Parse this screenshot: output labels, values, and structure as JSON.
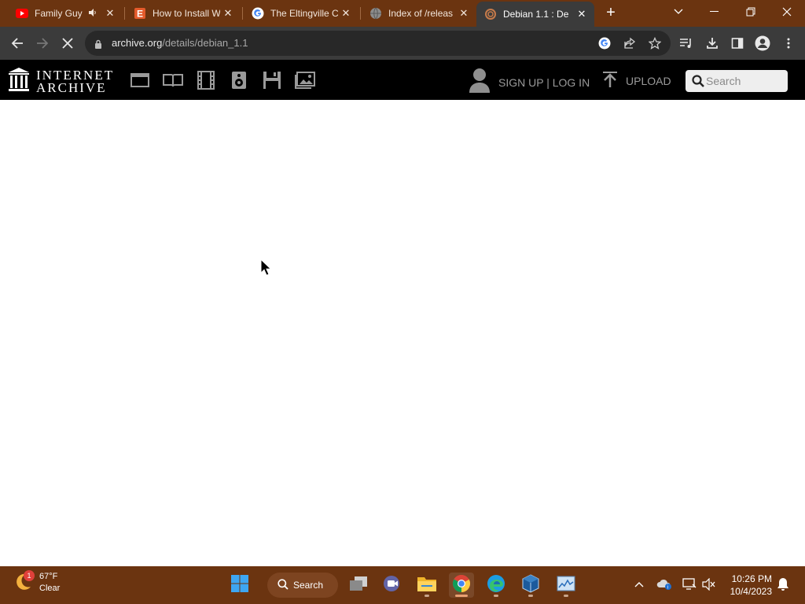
{
  "browser": {
    "tabs": [
      {
        "title": "Family Guy",
        "favicon": "youtube-icon",
        "audio": true,
        "active": false
      },
      {
        "title": "How to Install W",
        "favicon": "elementor-e-icon",
        "audio": false,
        "active": false
      },
      {
        "title": "The Eltingville C",
        "favicon": "google-g-icon",
        "audio": false,
        "active": false
      },
      {
        "title": "Index of /releas",
        "favicon": "globe-icon",
        "audio": false,
        "active": false
      },
      {
        "title": "Debian 1.1 : De",
        "favicon": "loading-archive-icon",
        "audio": false,
        "active": true
      }
    ],
    "address": {
      "host": "archive.org",
      "path": "/details/debian_1.1"
    }
  },
  "ia_header": {
    "logo_line1": "INTERNET",
    "logo_line2": "ARCHIVE",
    "media_icons": [
      "web-icon",
      "texts-icon",
      "video-icon",
      "audio-icon",
      "software-icon",
      "images-icon"
    ],
    "signup_label": "SIGN UP | LOG IN",
    "upload_label": "UPLOAD",
    "search_placeholder": "Search"
  },
  "taskbar": {
    "weather": {
      "temp": "67°F",
      "condition": "Clear",
      "badge": "1"
    },
    "search_label": "Search",
    "time": "10:26 PM",
    "date": "10/4/2023"
  },
  "colors": {
    "tabstrip": "#6b3410",
    "toolbar": "#3b3b3b",
    "ia_header": "#000000",
    "taskbar": "#6b3410"
  }
}
